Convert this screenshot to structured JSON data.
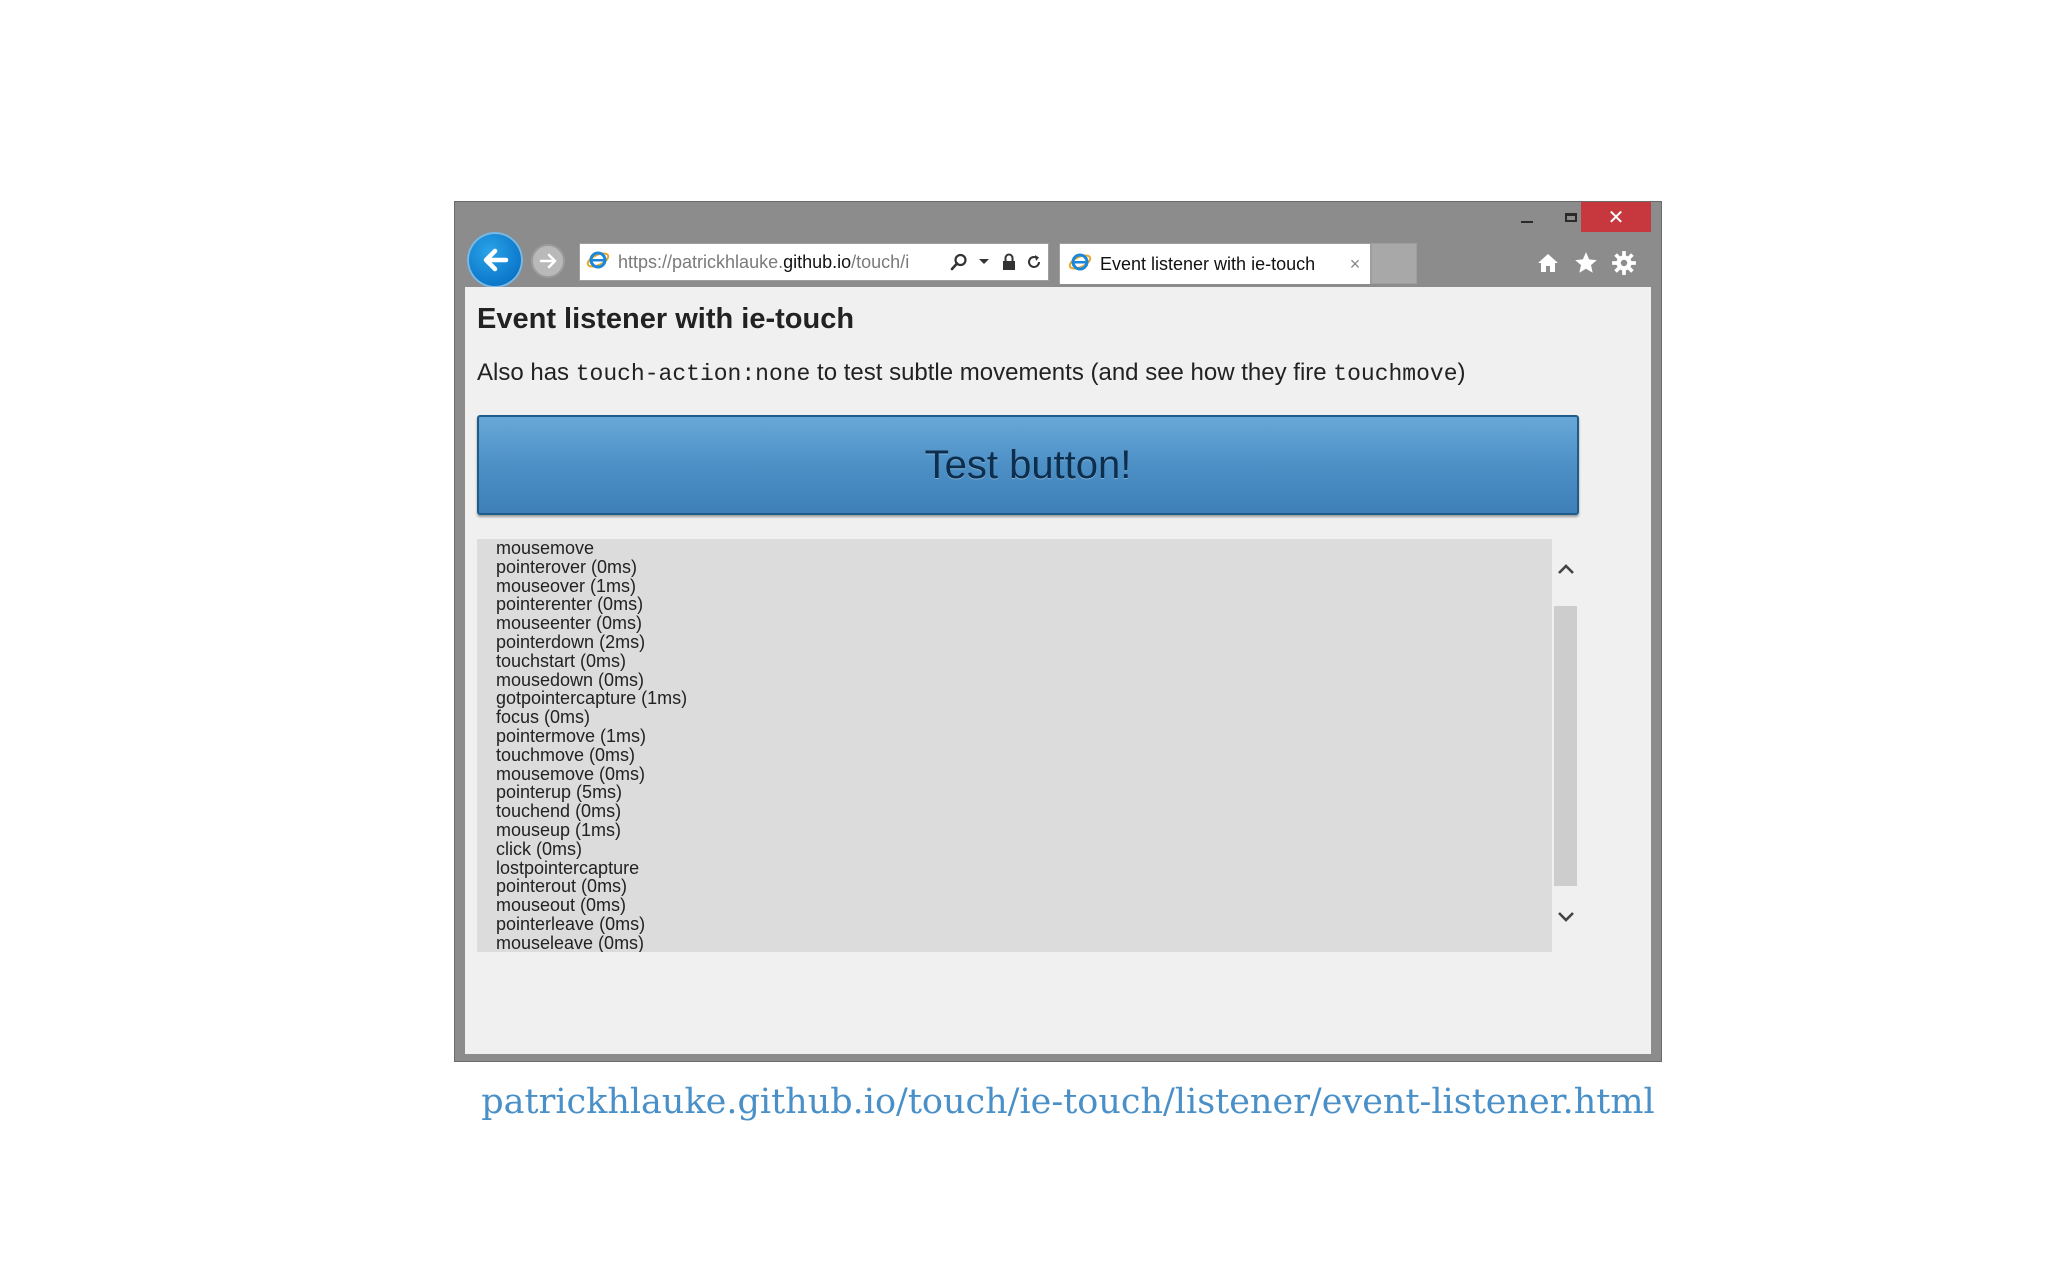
{
  "browser": {
    "url_scheme": "https://",
    "url_host_prefix": "patrickhlauke.",
    "url_host": "github.io",
    "url_path": "/touch/i",
    "tab_title": "Event listener with ie-touch",
    "tab_close": "×",
    "close_glyph": "✕",
    "accent_color": "#0b76c9",
    "close_color": "#c7383e"
  },
  "page": {
    "title": "Event listener with ie-touch",
    "desc_pre": "Also has ",
    "desc_code1": "touch-action:none",
    "desc_mid": " to test subtle movements (and see how they fire ",
    "desc_code2": "touchmove",
    "desc_post": ")",
    "button_label": "Test button!",
    "button_color": "#4d90c6",
    "log": [
      "mousemove",
      "pointerover (0ms)",
      "mouseover (1ms)",
      "pointerenter (0ms)",
      "mouseenter (0ms)",
      "pointerdown (2ms)",
      "touchstart (0ms)",
      "mousedown (0ms)",
      "gotpointercapture (1ms)",
      "focus (0ms)",
      "pointermove (1ms)",
      "touchmove (0ms)",
      "mousemove (0ms)",
      "pointerup (5ms)",
      "touchend (0ms)",
      "mouseup (1ms)",
      "click (0ms)",
      "lostpointercapture",
      "pointerout (0ms)",
      "mouseout (0ms)",
      "pointerleave (0ms)",
      "mouseleave (0ms)"
    ]
  },
  "caption": {
    "link_text": "patrickhlauke.github.io/touch/ie-touch/listener/event-listener.html",
    "color": "#4a90c8"
  }
}
